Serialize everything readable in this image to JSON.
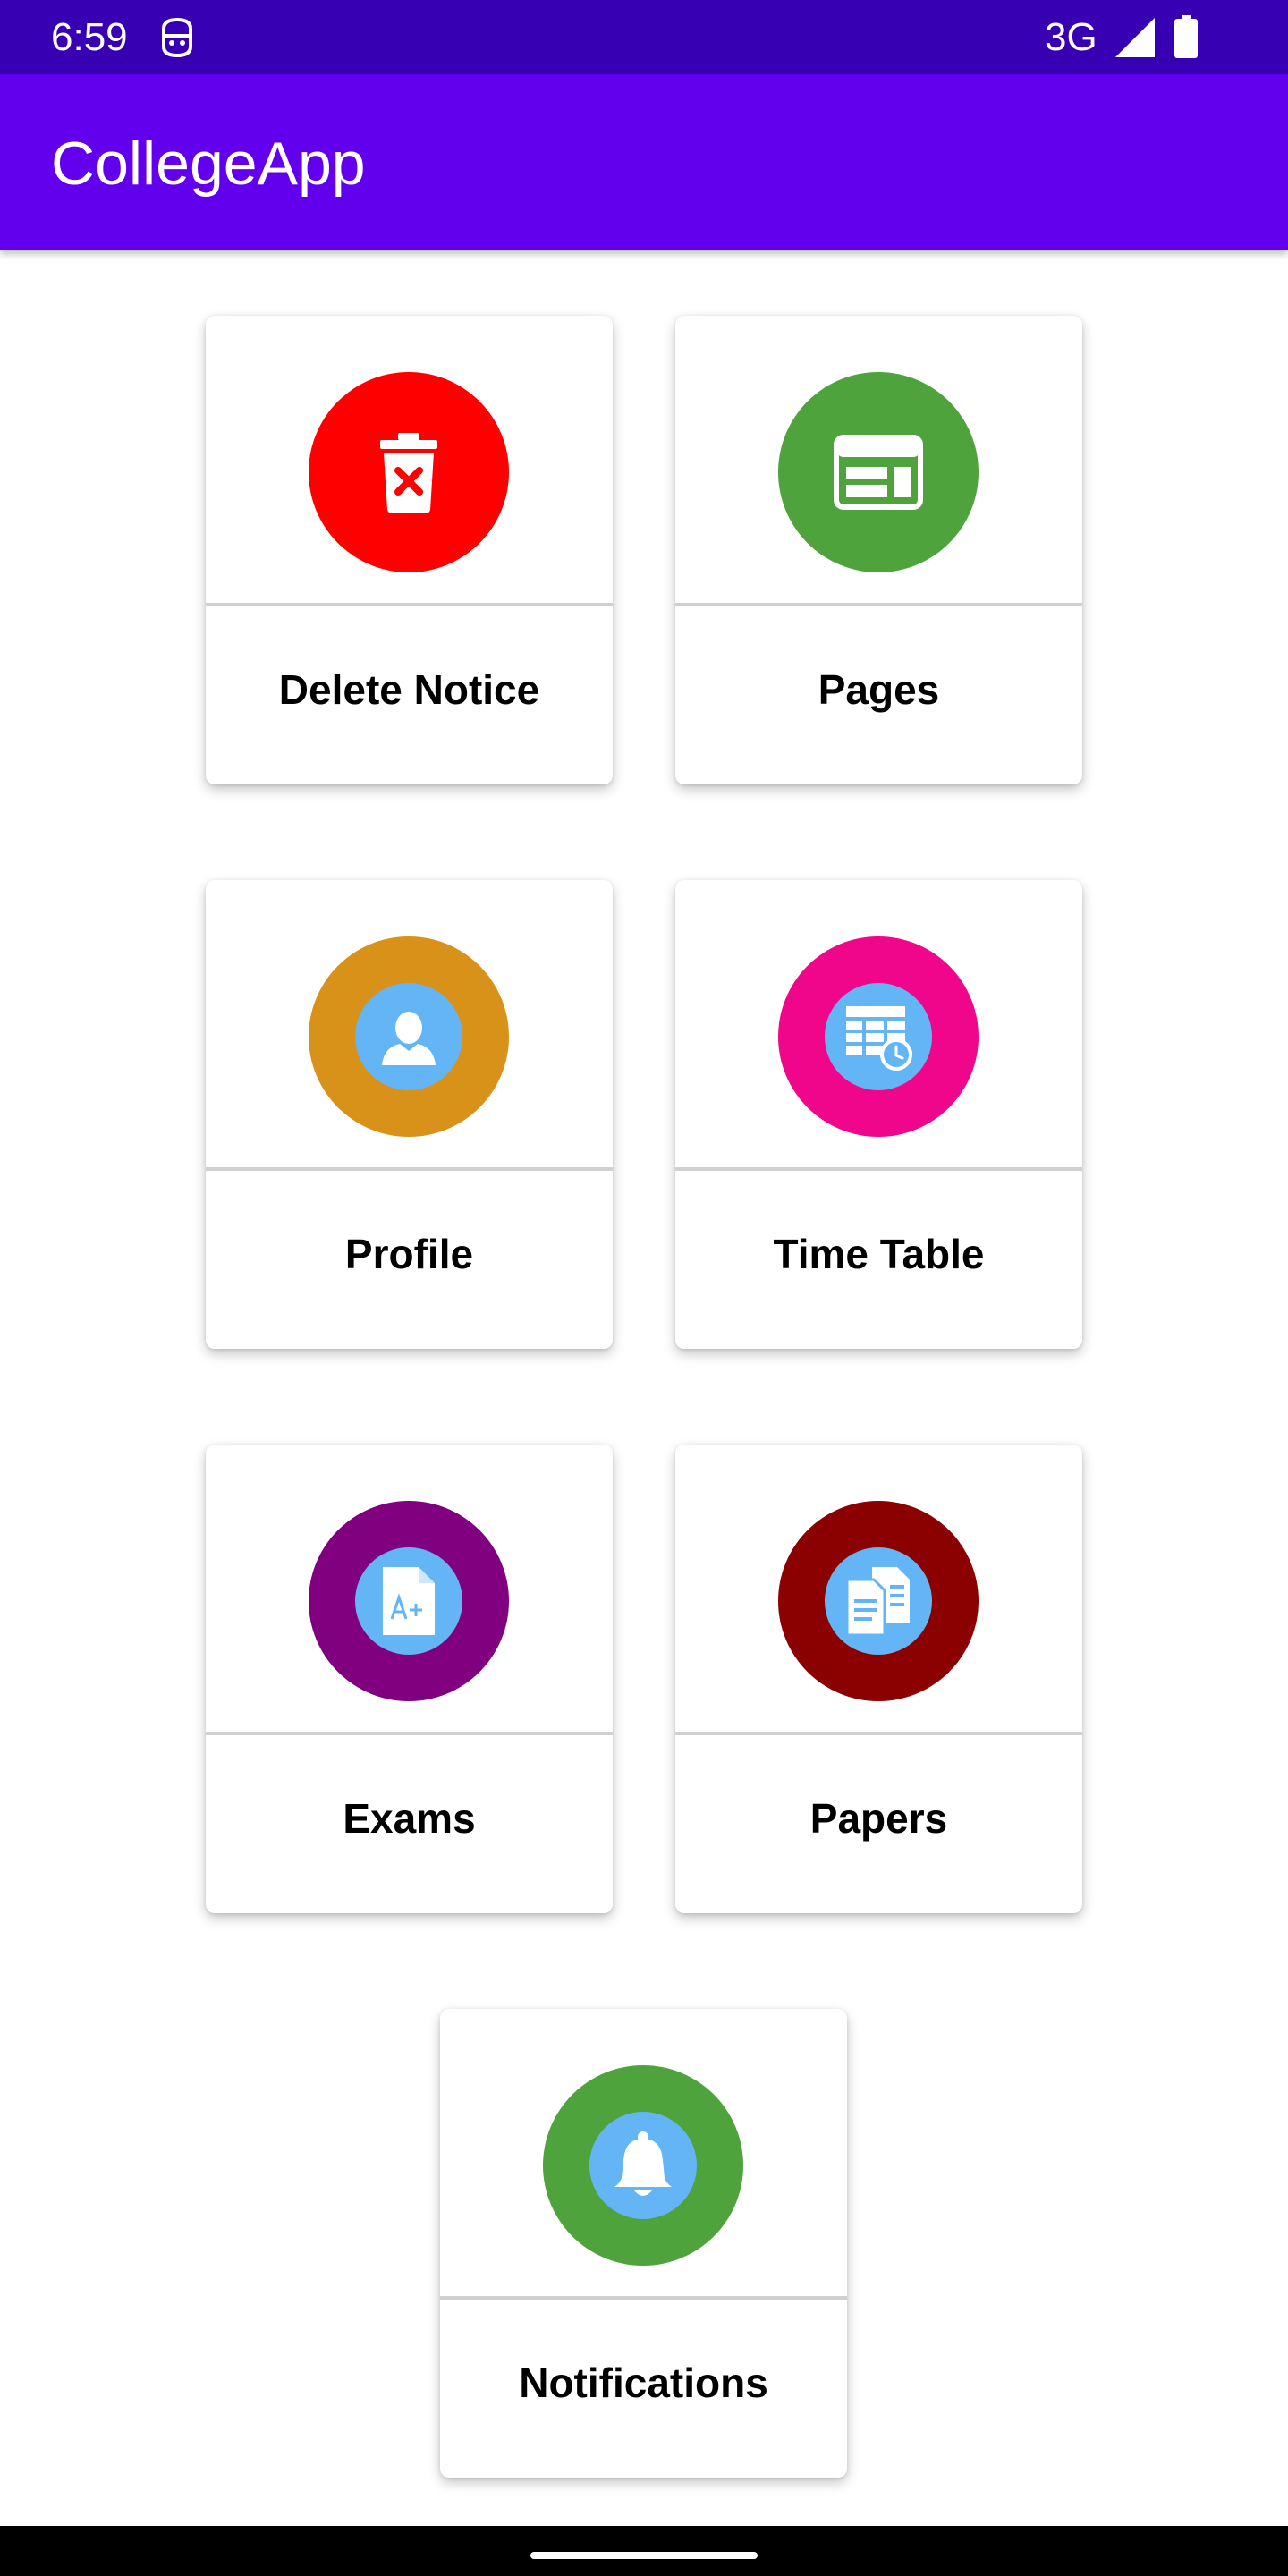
{
  "status_bar": {
    "time": "6:59",
    "network": "3G",
    "icons": [
      "face-icon",
      "signal-icon",
      "battery-icon"
    ]
  },
  "app_bar": {
    "title": "CollegeApp"
  },
  "menu": [
    {
      "label": "Delete Notice",
      "icon": "delete-notice-icon",
      "color": "#ff0000"
    },
    {
      "label": "Pages",
      "icon": "pages-icon",
      "color": "#4fa33d"
    },
    {
      "label": "Profile",
      "icon": "profile-icon",
      "color": "#d8921a"
    },
    {
      "label": "Time Table",
      "icon": "timetable-icon",
      "color": "#f0068b"
    },
    {
      "label": "Exams",
      "icon": "exams-icon",
      "color": "#800080"
    },
    {
      "label": "Papers",
      "icon": "papers-icon",
      "color": "#8b0000"
    },
    {
      "label": "Notifications",
      "icon": "notifications-icon",
      "color": "#4fa33d"
    }
  ],
  "colors": {
    "status_bar": "#3700b3",
    "app_bar": "#6200ee",
    "icon_inner": "#64b5f6"
  }
}
